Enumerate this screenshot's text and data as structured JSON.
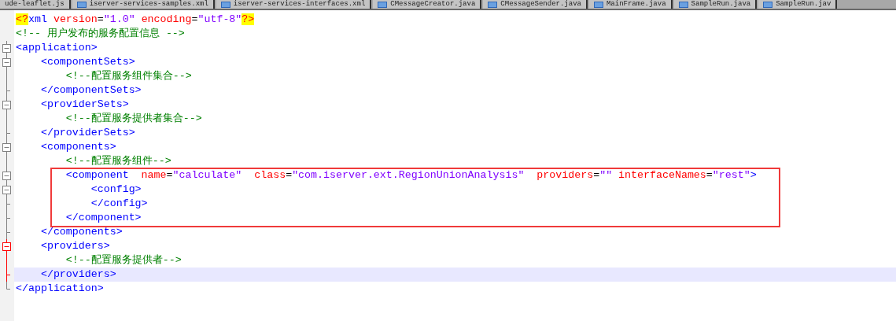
{
  "tabs": [
    {
      "label": "ude-leaflet.js",
      "icon": false
    },
    {
      "label": "iserver-services-samples.xml",
      "icon": true
    },
    {
      "label": "iserver-services-interfaces.xml",
      "icon": true
    },
    {
      "label": "CMessageCreator.java",
      "icon": true
    },
    {
      "label": "CMessageSender.java",
      "icon": true
    },
    {
      "label": "MainFrame.java",
      "icon": true
    },
    {
      "label": "SampleRun.java",
      "icon": true
    },
    {
      "label": "SampleRun.jav",
      "icon": true
    }
  ],
  "lines": [
    {
      "current": false,
      "boxed": false,
      "tokens": [
        {
          "kind": "pi",
          "t": "<?"
        },
        {
          "kind": "tag",
          "t": "xml"
        },
        {
          "kind": "attr",
          "t": " version"
        },
        {
          "kind": "plain",
          "t": "="
        },
        {
          "kind": "value",
          "t": "\"1.0\""
        },
        {
          "kind": "attr",
          "t": " encoding"
        },
        {
          "kind": "plain",
          "t": "="
        },
        {
          "kind": "value",
          "t": "\"utf-8\""
        },
        {
          "kind": "pi",
          "t": "?>"
        }
      ]
    },
    {
      "current": false,
      "boxed": false,
      "tokens": [
        {
          "kind": "comment",
          "t": "<!-- 用户发布的服务配置信息 -->"
        }
      ]
    },
    {
      "fold": {
        "kind": "box",
        "active": false
      },
      "current": false,
      "boxed": false,
      "tokens": [
        {
          "kind": "tag",
          "t": "<application>"
        }
      ]
    },
    {
      "fold": {
        "kind": "box",
        "active": false
      },
      "current": false,
      "boxed": false,
      "tokens": [
        {
          "kind": "tag",
          "t": "    <componentSets>"
        }
      ]
    },
    {
      "fold": {
        "kind": "line",
        "active": false
      },
      "current": false,
      "boxed": false,
      "tokens": [
        {
          "kind": "comment",
          "t": "        <!--配置服务组件集合-->"
        }
      ]
    },
    {
      "fold": {
        "kind": "end",
        "active": false
      },
      "current": false,
      "boxed": false,
      "tokens": [
        {
          "kind": "tag",
          "t": "    </componentSets>"
        }
      ]
    },
    {
      "fold": {
        "kind": "box",
        "active": false
      },
      "current": false,
      "boxed": false,
      "tokens": [
        {
          "kind": "tag",
          "t": "    <providerSets>"
        }
      ]
    },
    {
      "fold": {
        "kind": "line",
        "active": false
      },
      "current": false,
      "boxed": false,
      "tokens": [
        {
          "kind": "comment",
          "t": "        <!--配置服务提供者集合-->"
        }
      ]
    },
    {
      "fold": {
        "kind": "end",
        "active": false
      },
      "current": false,
      "boxed": false,
      "tokens": [
        {
          "kind": "tag",
          "t": "    </providerSets>"
        }
      ]
    },
    {
      "fold": {
        "kind": "box",
        "active": false
      },
      "current": false,
      "boxed": false,
      "tokens": [
        {
          "kind": "tag",
          "t": "    <components>"
        }
      ]
    },
    {
      "fold": {
        "kind": "line",
        "active": false
      },
      "current": false,
      "boxed": false,
      "tokens": [
        {
          "kind": "comment",
          "t": "        <!--配置服务组件-->"
        }
      ]
    },
    {
      "fold": {
        "kind": "box",
        "active": false
      },
      "current": false,
      "boxed": true,
      "tokens": [
        {
          "kind": "tag",
          "t": "        <component"
        },
        {
          "kind": "attr",
          "t": "  name"
        },
        {
          "kind": "plain",
          "t": "="
        },
        {
          "kind": "value",
          "t": "\"calculate\""
        },
        {
          "kind": "attr",
          "t": "  class"
        },
        {
          "kind": "plain",
          "t": "="
        },
        {
          "kind": "value",
          "t": "\"com.iserver.ext.RegionUnionAnalysis\""
        },
        {
          "kind": "attr",
          "t": "  providers"
        },
        {
          "kind": "plain",
          "t": "="
        },
        {
          "kind": "value",
          "t": "\"\""
        },
        {
          "kind": "attr",
          "t": " interfaceNames"
        },
        {
          "kind": "plain",
          "t": "="
        },
        {
          "kind": "value",
          "t": "\"rest\""
        },
        {
          "kind": "tag",
          "t": ">"
        }
      ]
    },
    {
      "fold": {
        "kind": "box",
        "active": false
      },
      "current": false,
      "boxed": true,
      "tokens": [
        {
          "kind": "tag",
          "t": "            <config>"
        }
      ]
    },
    {
      "fold": {
        "kind": "end",
        "active": false
      },
      "current": false,
      "boxed": true,
      "tokens": [
        {
          "kind": "tag",
          "t": "            </config>"
        }
      ]
    },
    {
      "fold": {
        "kind": "end",
        "active": false
      },
      "current": false,
      "boxed": true,
      "tokens": [
        {
          "kind": "tag",
          "t": "        </component>"
        }
      ]
    },
    {
      "fold": {
        "kind": "end",
        "active": false
      },
      "current": false,
      "boxed": false,
      "tokens": [
        {
          "kind": "tag",
          "t": "    </components>"
        }
      ]
    },
    {
      "fold": {
        "kind": "box",
        "active": true
      },
      "current": false,
      "boxed": false,
      "tokens": [
        {
          "kind": "tag",
          "t": "    <providers>"
        }
      ]
    },
    {
      "fold": {
        "kind": "line",
        "active": true
      },
      "current": false,
      "boxed": false,
      "tokens": [
        {
          "kind": "comment",
          "t": "        <!--配置服务提供者-->"
        }
      ]
    },
    {
      "fold": {
        "kind": "end",
        "active": true
      },
      "current": true,
      "boxed": false,
      "tokens": [
        {
          "kind": "tag",
          "t": "    </providers>"
        }
      ]
    },
    {
      "fold": {
        "kind": "last",
        "active": false
      },
      "current": false,
      "boxed": false,
      "tokens": [
        {
          "kind": "tag",
          "t": "</application>"
        }
      ]
    }
  ]
}
